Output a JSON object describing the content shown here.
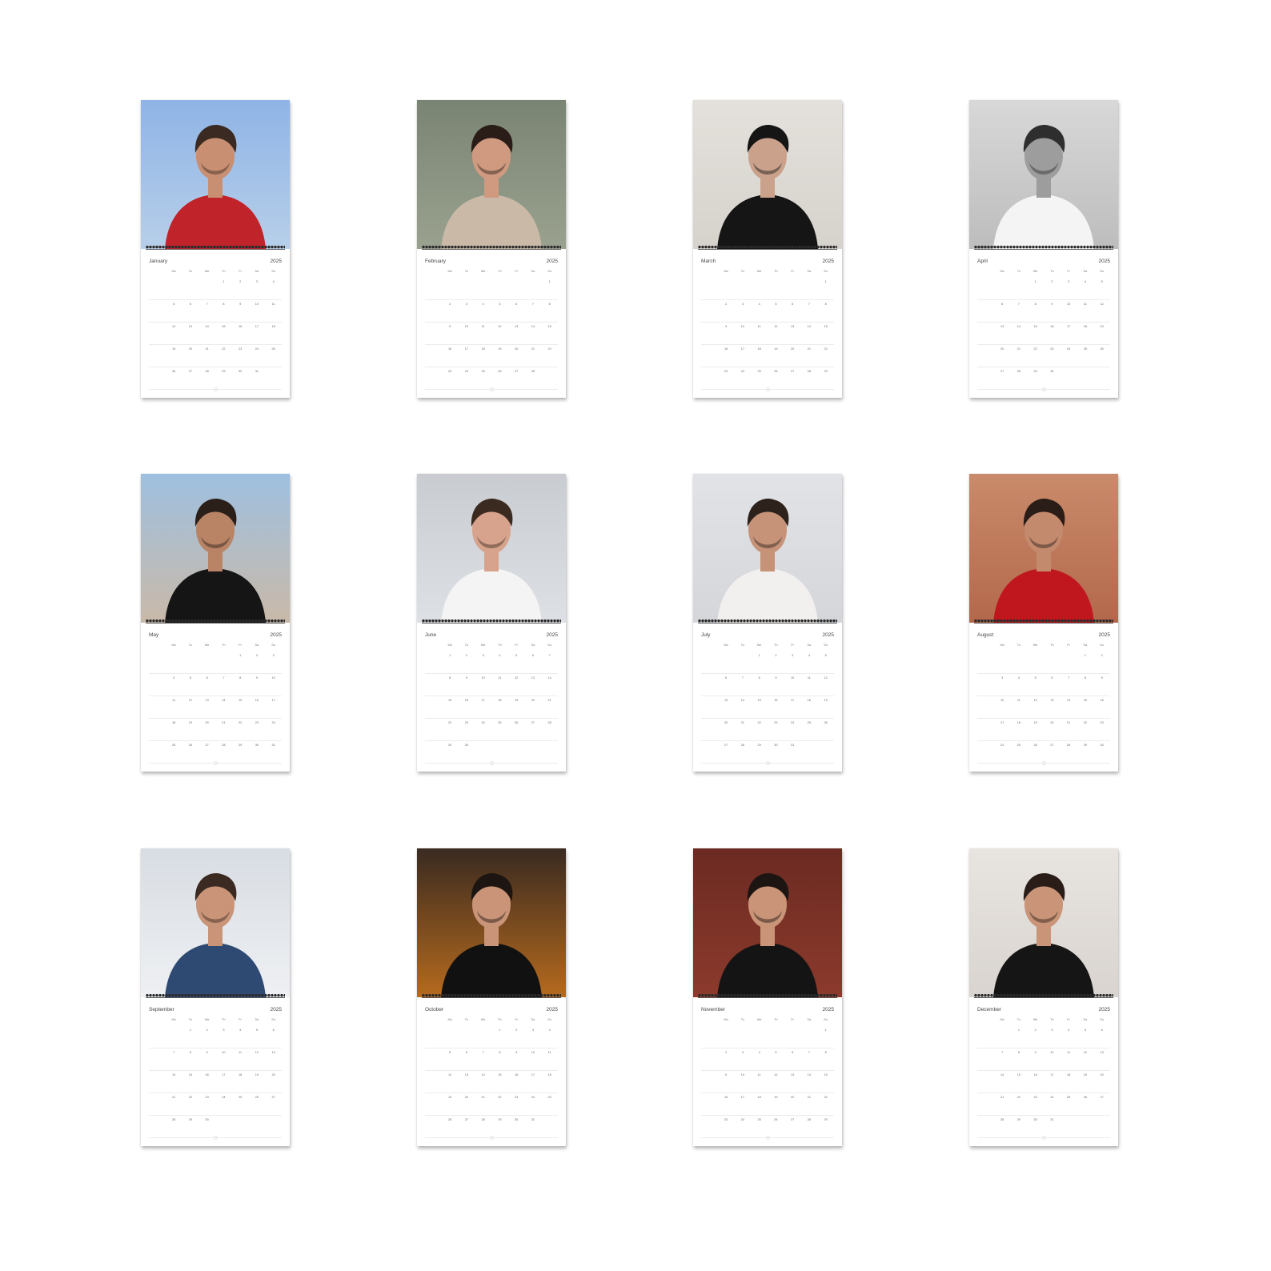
{
  "year": "2025",
  "weekday_labels": [
    "",
    "Mo",
    "Tu",
    "We",
    "Th",
    "Fr",
    "Sa",
    "Su"
  ],
  "months": [
    {
      "name": "January",
      "first_weekday": 3,
      "days": 31,
      "photo": {
        "bg_top": "#8fb4e6",
        "bg_bottom": "#b7cfe9",
        "shirt": "#c0242a",
        "skin": "#c98f72",
        "hair": "#3a2a22"
      }
    },
    {
      "name": "February",
      "first_weekday": 6,
      "days": 28,
      "photo": {
        "bg_top": "#7a8473",
        "bg_bottom": "#9aa18f",
        "shirt": "#c9b9a6",
        "skin": "#cf9a80",
        "hair": "#2a1d18"
      }
    },
    {
      "name": "March",
      "first_weekday": 6,
      "days": 31,
      "photo": {
        "bg_top": "#e4e1dc",
        "bg_bottom": "#d6d2cc",
        "shirt": "#151515",
        "skin": "#caa18a",
        "hair": "#151515"
      }
    },
    {
      "name": "April",
      "first_weekday": 2,
      "days": 30,
      "photo": {
        "bg_top": "#d8d8d8",
        "bg_bottom": "#bdbdbd",
        "shirt": "#f4f4f4",
        "skin": "#9d9d9d",
        "hair": "#2e2e2e"
      }
    },
    {
      "name": "May",
      "first_weekday": 4,
      "days": 31,
      "photo": {
        "bg_top": "#9ec0e0",
        "bg_bottom": "#c9b9a8",
        "shirt": "#151515",
        "skin": "#b98466",
        "hair": "#2b1f19"
      }
    },
    {
      "name": "June",
      "first_weekday": 0,
      "days": 30,
      "photo": {
        "bg_top": "#c9ccd1",
        "bg_bottom": "#dde0e4",
        "shirt": "#f4f4f4",
        "skin": "#d7a38c",
        "hair": "#3b2a20"
      }
    },
    {
      "name": "July",
      "first_weekday": 2,
      "days": 31,
      "photo": {
        "bg_top": "#e1e3e6",
        "bg_bottom": "#d4d6da",
        "shirt": "#f1f0ee",
        "skin": "#c79378",
        "hair": "#2d211b"
      }
    },
    {
      "name": "August",
      "first_weekday": 5,
      "days": 31,
      "photo": {
        "bg_top": "#c98b6b",
        "bg_bottom": "#b3684b",
        "shirt": "#c0171e",
        "skin": "#c48a6d",
        "hair": "#2a1d18"
      }
    },
    {
      "name": "September",
      "first_weekday": 1,
      "days": 30,
      "photo": {
        "bg_top": "#d8dde3",
        "bg_bottom": "#eef0f3",
        "shirt": "#2f4a72",
        "skin": "#c99477",
        "hair": "#3a2a22"
      }
    },
    {
      "name": "October",
      "first_weekday": 3,
      "days": 31,
      "photo": {
        "bg_top": "#3a2a20",
        "bg_bottom": "#b56a1e",
        "shirt": "#111111",
        "skin": "#c99477",
        "hair": "#1d1511"
      }
    },
    {
      "name": "November",
      "first_weekday": 6,
      "days": 30,
      "photo": {
        "bg_top": "#6b2a22",
        "bg_bottom": "#8c3a2c",
        "shirt": "#141414",
        "skin": "#c99477",
        "hair": "#1d1511"
      }
    },
    {
      "name": "December",
      "first_weekday": 1,
      "days": 31,
      "photo": {
        "bg_top": "#e8e4e0",
        "bg_bottom": "#d9d4cf",
        "shirt": "#151515",
        "skin": "#c99477",
        "hair": "#2a1d18"
      }
    }
  ]
}
